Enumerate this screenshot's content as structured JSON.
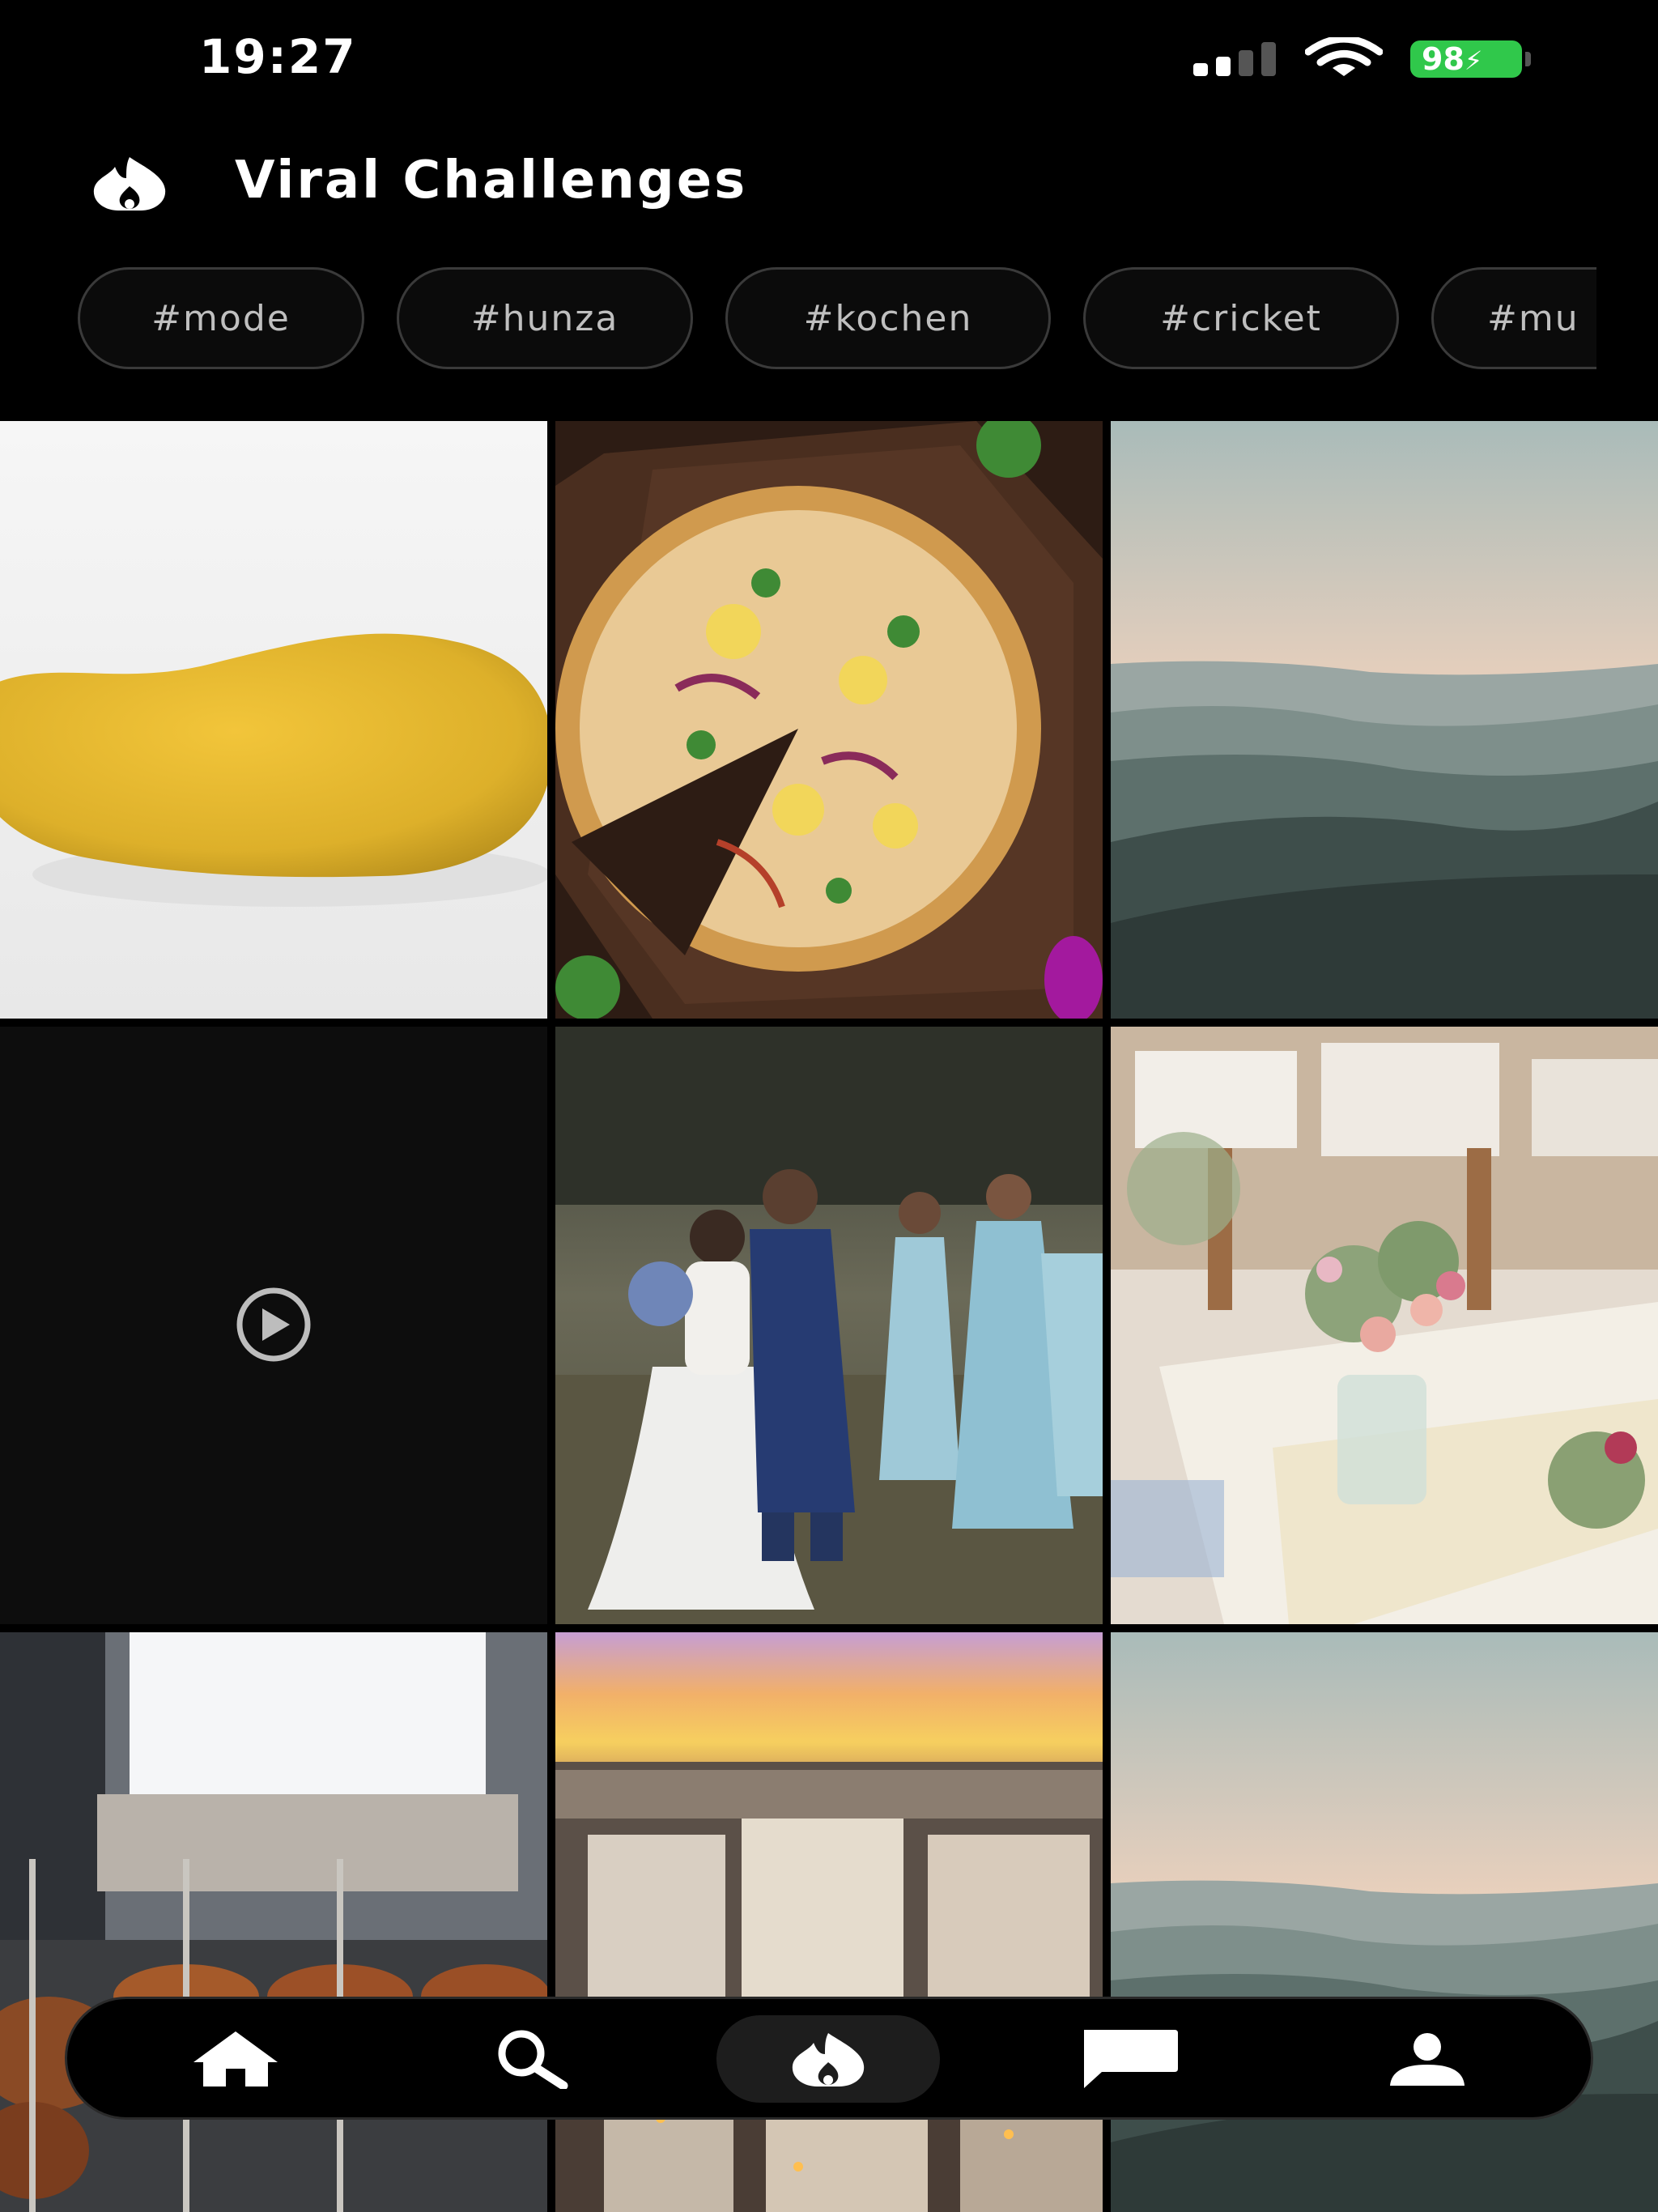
{
  "status_bar": {
    "time": "19:27",
    "battery": "98"
  },
  "header": {
    "title": "Viral Challenges"
  },
  "hashtags": [
    "#mode",
    "#hunza",
    "#kochen",
    "#cricket",
    "#mu"
  ],
  "grid": [
    {
      "subject": "mango"
    },
    {
      "subject": "pizza"
    },
    {
      "subject": "misty mountains"
    },
    {
      "subject": "video",
      "icon": "play-circle-icon"
    },
    {
      "subject": "wedding kiss"
    },
    {
      "subject": "floral table"
    },
    {
      "subject": "grilled skewers"
    },
    {
      "subject": "city sunset"
    },
    {
      "subject": "misty mountains"
    }
  ],
  "nav": {
    "items": [
      {
        "icon": "home-icon"
      },
      {
        "icon": "search-icon"
      },
      {
        "icon": "flame-icon",
        "active": true
      },
      {
        "icon": "chat-icon"
      },
      {
        "icon": "profile-icon"
      }
    ]
  },
  "colors": {
    "battery": "#30c84b",
    "background": "#000000",
    "chip_border": "#3a3a3a"
  }
}
